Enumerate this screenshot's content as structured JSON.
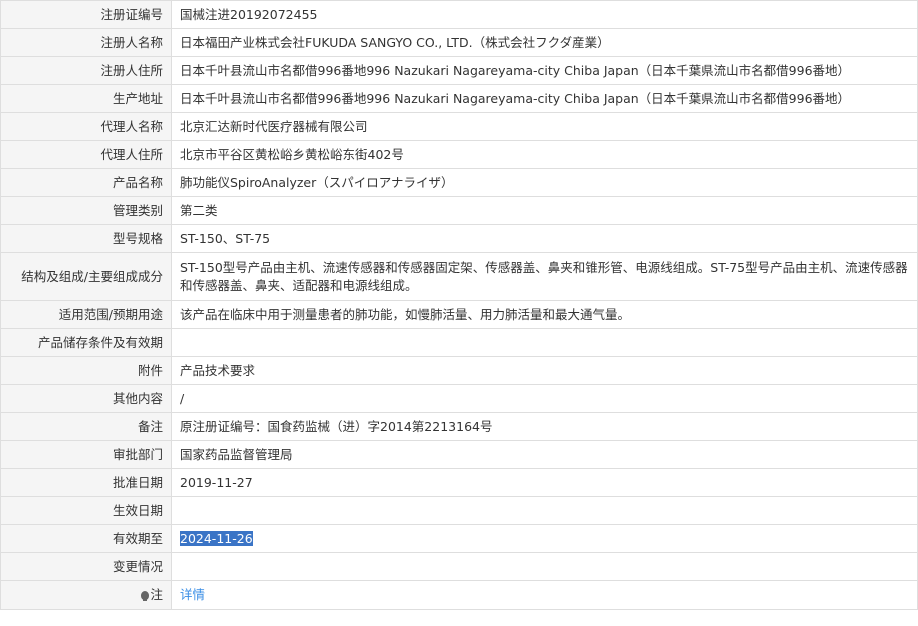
{
  "rows": [
    {
      "label": "注册证编号",
      "value": "国械注进20192072455"
    },
    {
      "label": "注册人名称",
      "value": "日本福田产业株式会社FUKUDA SANGYO CO., LTD.（株式会社フクダ産業）"
    },
    {
      "label": "注册人住所",
      "value": "日本千叶县流山市名都借996番地996 Nazukari Nagareyama-city Chiba Japan（日本千葉県流山市名都借996番地）"
    },
    {
      "label": "生产地址",
      "value": "日本千叶县流山市名都借996番地996 Nazukari Nagareyama-city Chiba Japan（日本千葉県流山市名都借996番地）"
    },
    {
      "label": "代理人名称",
      "value": "北京汇达新时代医疗器械有限公司"
    },
    {
      "label": "代理人住所",
      "value": "北京市平谷区黄松峪乡黄松峪东街402号"
    },
    {
      "label": "产品名称",
      "value": "肺功能仪SpiroAnalyzer（スパイロアナライザ）"
    },
    {
      "label": "管理类别",
      "value": "第二类"
    },
    {
      "label": "型号规格",
      "value": "ST-150、ST-75"
    },
    {
      "label": "结构及组成/主要组成成分",
      "value": "ST-150型号产品由主机、流速传感器和传感器固定架、传感器盖、鼻夹和锥形管、电源线组成。ST-75型号产品由主机、流速传感器和传感器盖、鼻夹、适配器和电源线组成。"
    },
    {
      "label": "适用范围/预期用途",
      "value": "该产品在临床中用于测量患者的肺功能，如慢肺活量、用力肺活量和最大通气量。"
    },
    {
      "label": "产品储存条件及有效期",
      "value": ""
    },
    {
      "label": "附件",
      "value": "产品技术要求"
    },
    {
      "label": "其他内容",
      "value": "/"
    },
    {
      "label": "备注",
      "value": "原注册证编号：国食药监械（进）字2014第2213164号"
    },
    {
      "label": "审批部门",
      "value": "国家药品监督管理局"
    },
    {
      "label": "批准日期",
      "value": "2019-11-27"
    },
    {
      "label": "生效日期",
      "value": ""
    },
    {
      "label": "有效期至",
      "value": "2024-11-26"
    },
    {
      "label": "变更情况",
      "value": ""
    },
    {
      "label": "注",
      "value": "详情",
      "icon": "lightbulb-icon"
    }
  ]
}
